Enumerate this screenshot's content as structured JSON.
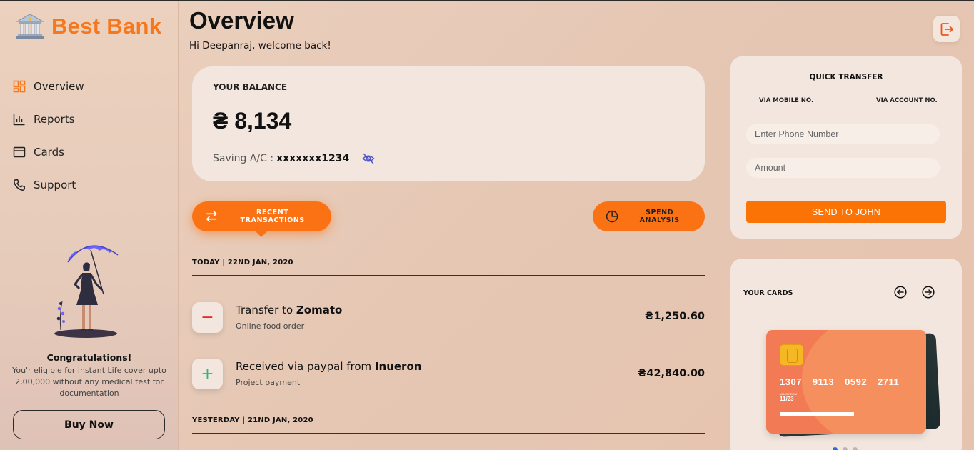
{
  "brand": {
    "name": "Best Bank"
  },
  "nav": [
    {
      "label": "Overview",
      "icon": "dashboard-icon",
      "active": true
    },
    {
      "label": "Reports",
      "icon": "bar-chart-icon"
    },
    {
      "label": "Cards",
      "icon": "card-icon"
    },
    {
      "label": "Support",
      "icon": "phone-icon"
    }
  ],
  "promo": {
    "title": "Congratulations!",
    "text": "You'r eligible for instant Life cover upto 2,00,000 without any medical test for documentation",
    "button": "Buy Now"
  },
  "header": {
    "title": "Overview",
    "welcome": "Hi Deepanraj, welcome back!"
  },
  "balance": {
    "label": "YOUR BALANCE",
    "amount": "₴ 8,134",
    "account_label": "Saving A/C :",
    "account_number": "xxxxxxx1234"
  },
  "actions": {
    "recent": "RECENT TRANSACTIONS",
    "spend": "SPEND ANALYSIS"
  },
  "days": [
    {
      "heading": "TODAY | 22ND JAN, 2020",
      "transactions": [
        {
          "type": "debit",
          "sign": "−",
          "prefix": "Transfer to ",
          "party": "Zomato",
          "note": "Online food order",
          "amount": "₴1,250.60"
        },
        {
          "type": "credit",
          "sign": "+",
          "prefix": "Received via paypal from ",
          "party": "Inueron",
          "note": "Project payment",
          "amount": "₴42,840.00"
        }
      ]
    },
    {
      "heading": "YESTERDAY | 21ND JAN, 2020",
      "transactions": []
    }
  ],
  "quick_transfer": {
    "title": "QUICK TRANSFER",
    "tab_mobile": "VIA MOBILE NO.",
    "tab_account": "VIA ACCOUNT NO.",
    "phone_placeholder": "Enter Phone Number",
    "amount_placeholder": "Amount",
    "send": "SEND TO JOHN"
  },
  "cards": {
    "title": "YOUR CARDS",
    "number_groups": [
      "1307",
      "9113",
      "0592",
      "2711"
    ],
    "valid_label": "VALID FROM",
    "valid": "11/23",
    "dots": 3,
    "active_dot": 0
  },
  "colors": {
    "accent": "#fb7215",
    "brand": "#f5781e",
    "card": "#f27a55",
    "debit": "#e02b2b",
    "credit": "#2bb58a",
    "eye": "#4a55c8"
  }
}
